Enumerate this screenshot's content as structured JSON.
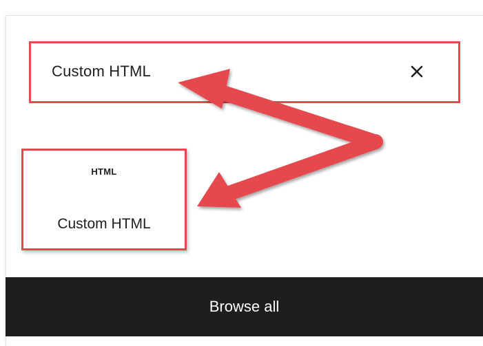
{
  "search": {
    "value": "Custom HTML"
  },
  "results": [
    {
      "icon_text": "HTML",
      "label": "Custom HTML"
    }
  ],
  "footer": {
    "browse_label": "Browse all"
  },
  "icons": {
    "clear": "close-icon"
  },
  "colors": {
    "highlight": "#e5484d",
    "footer_bg": "#1e1e1e",
    "text": "#1e1e1e"
  }
}
